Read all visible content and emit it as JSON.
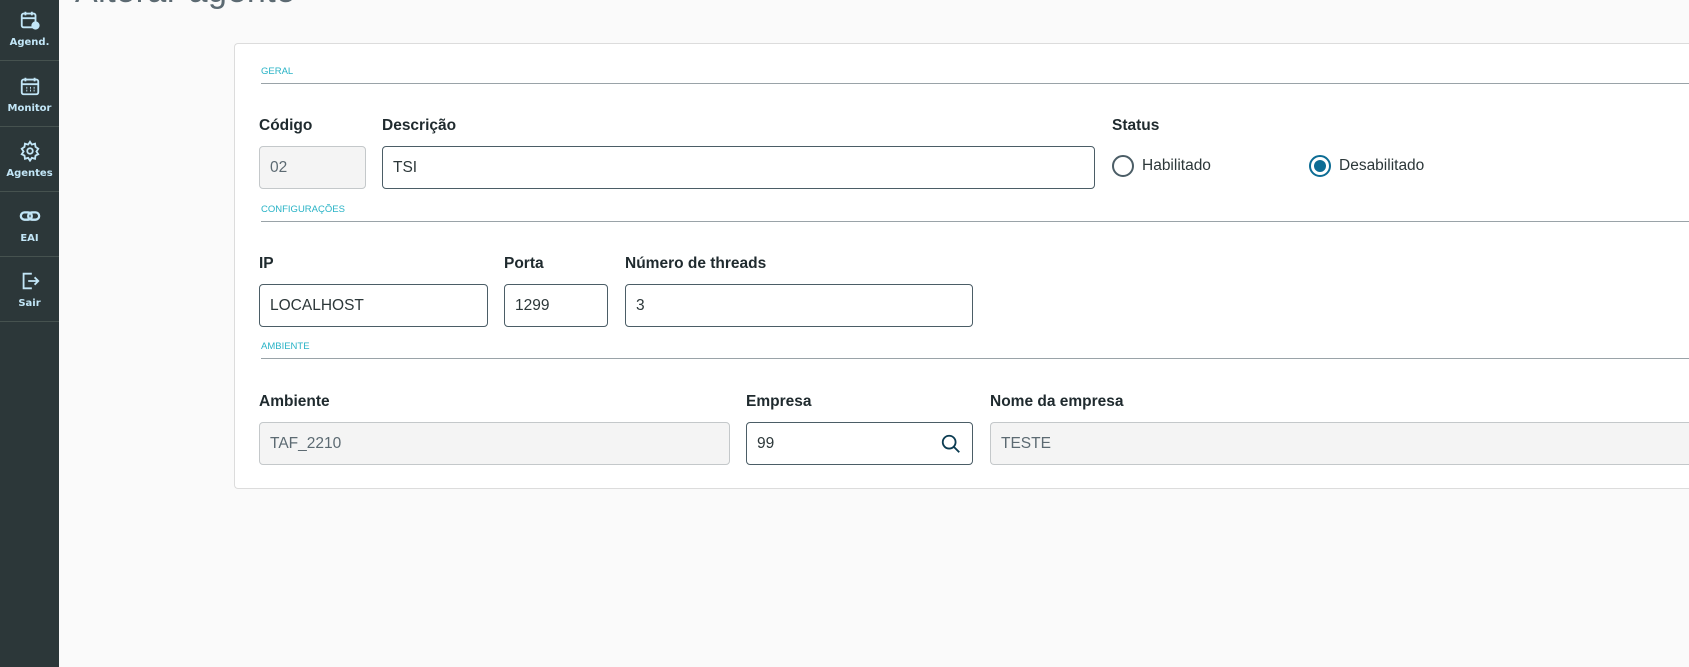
{
  "page_title": "Alterar agente",
  "sidebar": {
    "items": [
      {
        "label": "Agend.",
        "icon": "calendar-gear-icon"
      },
      {
        "label": "Monitor",
        "icon": "calendar-icon"
      },
      {
        "label": "Agentes",
        "icon": "gear-icon"
      },
      {
        "label": "EAI",
        "icon": "link-icon"
      },
      {
        "label": "Sair",
        "icon": "logout-icon"
      }
    ]
  },
  "form": {
    "sections": {
      "geral": "GERAL",
      "config": "CONFIGURAÇÕES",
      "ambiente": "AMBIENTE"
    },
    "codigo": {
      "label": "Código",
      "value": "02"
    },
    "descricao": {
      "label": "Descrição",
      "value": "TSI"
    },
    "status": {
      "label": "Status",
      "options": [
        "Habilitado",
        "Desabilitado"
      ],
      "selected": "Desabilitado"
    },
    "ip": {
      "label": "IP",
      "value": "LOCALHOST"
    },
    "porta": {
      "label": "Porta",
      "value": "1299"
    },
    "threads": {
      "label": "Número de threads",
      "value": "3"
    },
    "ambiente": {
      "label": "Ambiente",
      "value": "TAF_2210"
    },
    "empresa": {
      "label": "Empresa",
      "value": "99"
    },
    "nome_empresa": {
      "label": "Nome da empresa",
      "value": "TESTE"
    }
  },
  "colors": {
    "sidebar": "#2c3739",
    "accent": "#0c6c94",
    "section": "#29b3c6"
  }
}
